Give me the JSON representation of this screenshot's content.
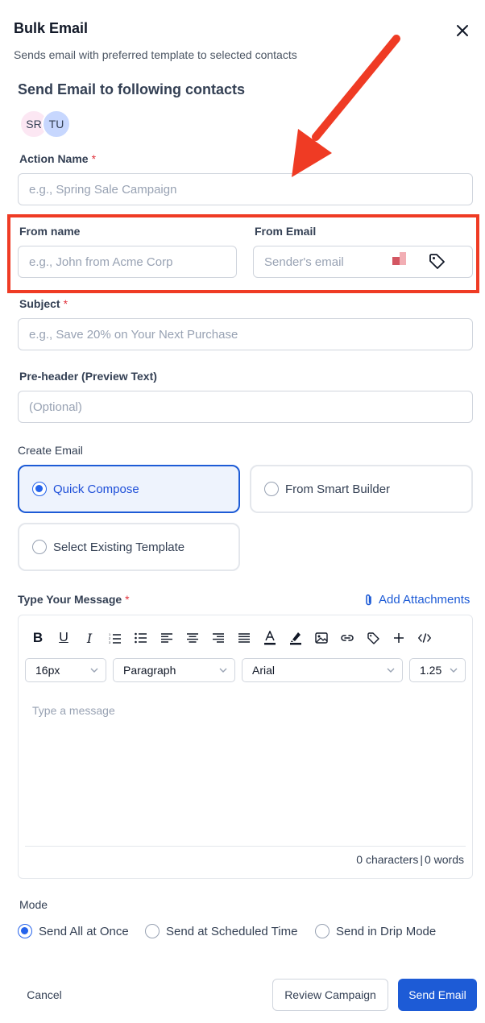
{
  "header": {
    "title": "Bulk Email",
    "subtitle": "Sends email with preferred template to selected contacts",
    "close_icon": "close-icon"
  },
  "recipients": {
    "title": "Send Email to following contacts",
    "avatars": [
      "SR",
      "TU"
    ]
  },
  "action_name": {
    "label": "Action Name",
    "required_mark": "*",
    "placeholder": "e.g., Spring Sale Campaign"
  },
  "from_name": {
    "label": "From name",
    "placeholder": "e.g., John from Acme Corp"
  },
  "from_email": {
    "label": "From Email",
    "placeholder": "Sender's email",
    "icons": [
      "squares-icon",
      "tag-icon"
    ]
  },
  "subject": {
    "label": "Subject",
    "required_mark": "*",
    "placeholder": "e.g., Save 20% on Your Next Purchase"
  },
  "preheader": {
    "label": "Pre-header (Preview Text)",
    "placeholder": "(Optional)"
  },
  "create_email": {
    "label": "Create Email",
    "options": [
      "Quick Compose",
      "From Smart Builder",
      "Select Existing Template"
    ],
    "selected": "Quick Compose"
  },
  "message": {
    "label": "Type Your Message",
    "required_mark": "*",
    "add_attachments": "Add Attachments",
    "toolbar": {
      "bold": "B",
      "underline": "U",
      "italic": "I",
      "icons": [
        "ordered-list-icon",
        "bullet-list-icon",
        "align-left-icon",
        "align-center-icon",
        "align-right-icon",
        "align-justify-icon",
        "text-color-icon",
        "highlight-icon",
        "image-icon",
        "link-icon",
        "tag-icon",
        "plus-icon",
        "code-icon"
      ]
    },
    "font_size": "16px",
    "block_format": "Paragraph",
    "font_family": "Arial",
    "line_height": "1.25",
    "placeholder": "Type a message",
    "char_count": "0 characters",
    "separator": "|",
    "word_count": "0 words"
  },
  "mode": {
    "label": "Mode",
    "options": [
      "Send All at Once",
      "Send at Scheduled Time",
      "Send in Drip Mode"
    ],
    "selected": "Send All at Once"
  },
  "footer": {
    "cancel": "Cancel",
    "review": "Review Campaign",
    "send": "Send Email"
  },
  "colors": {
    "accent": "#1d5bd6",
    "highlight_annotation": "#ef3b24",
    "required": "#e0313b"
  }
}
